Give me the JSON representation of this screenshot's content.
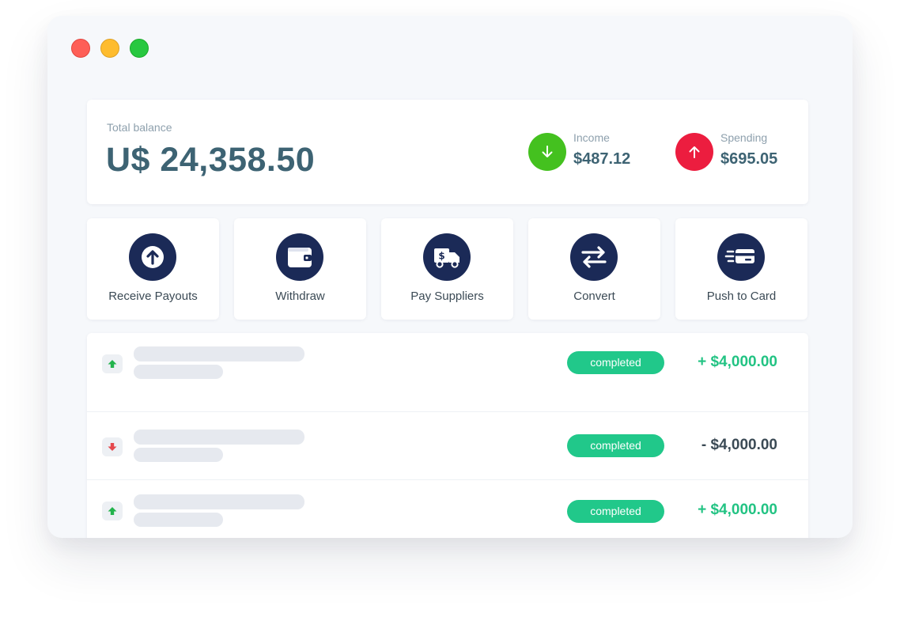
{
  "balance": {
    "label": "Total balance",
    "amount": "U$ 24,358.50"
  },
  "stats": {
    "income": {
      "label": "Income",
      "value": "$487.12",
      "icon": "arrow-down-icon",
      "color": "#44c11f"
    },
    "spending": {
      "label": "Spending",
      "value": "$695.05",
      "icon": "arrow-up-icon",
      "color": "#ec1d3f"
    }
  },
  "actions": [
    {
      "label": "Receive Payouts",
      "icon": "upload-circle-icon"
    },
    {
      "label": "Withdraw",
      "icon": "wallet-icon"
    },
    {
      "label": "Pay Suppliers",
      "icon": "delivery-truck-icon"
    },
    {
      "label": "Convert",
      "icon": "exchange-arrows-icon"
    },
    {
      "label": "Push to Card",
      "icon": "fast-card-icon"
    }
  ],
  "transactions": [
    {
      "direction": "in",
      "status": "completed",
      "amount": "+ $4,000.00"
    },
    {
      "direction": "out",
      "status": "completed",
      "amount": "- $4,000.00"
    },
    {
      "direction": "in",
      "status": "completed",
      "amount": "+ $4,000.00"
    }
  ],
  "colors": {
    "accent_navy": "#1b2a57",
    "status_green": "#21c88a",
    "income_text": "#22c383"
  }
}
